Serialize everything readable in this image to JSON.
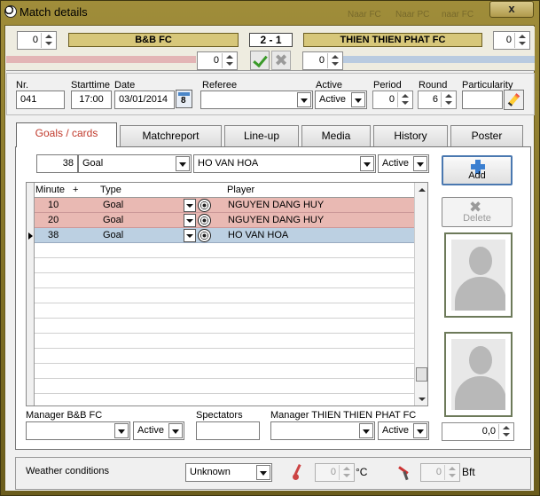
{
  "window": {
    "title": "Match details",
    "ghost_labels": [
      "Naar FC",
      "Naar PC",
      "naar FC"
    ],
    "close_label": "x"
  },
  "score": {
    "home_team": "B&B FC",
    "away_team": "THIEN THIEN PHAT FC",
    "result": "2  - 1",
    "home_left_value": "0",
    "away_right_value": "0",
    "home_sub_value": "0",
    "away_sub_value": "0",
    "colors": {
      "home_bar": "#e3b5b5",
      "away_bar": "#b9cbe0",
      "team_box": "#d7c77a"
    }
  },
  "info": {
    "nr_label": "Nr.",
    "nr_value": "041",
    "starttime_label": "Starttime",
    "starttime_value": "17:00",
    "date_label": "Date",
    "date_value": "03/01/2014",
    "referee_label": "Referee",
    "referee_value": "",
    "active_label": "Active",
    "active_value": "Active",
    "period_label": "Period",
    "period_value": "0",
    "round_label": "Round",
    "round_value": "6",
    "particularity_label": "Particularity",
    "particularity_value": ""
  },
  "tabs": [
    "Goals / cards",
    "Matchreport",
    "Line-up",
    "Media",
    "History",
    "Poster"
  ],
  "entry": {
    "minute": "38",
    "type": "Goal",
    "player": "HO VAN HOA",
    "status": "Active"
  },
  "grid": {
    "headers": {
      "minute": "Minute",
      "plus": "+",
      "type": "Type",
      "player": "Player"
    },
    "rows": [
      {
        "minute": "10",
        "type": "Goal",
        "player": "NGUYEN DANG HUY",
        "team": "home"
      },
      {
        "minute": "20",
        "type": "Goal",
        "player": "NGUYEN DANG HUY",
        "team": "home"
      },
      {
        "minute": "38",
        "type": "Goal",
        "player": "HO VAN HOA",
        "team": "away"
      }
    ],
    "colors": {
      "home_row": "#e9b9b3",
      "away_row": "#bcd0e2"
    }
  },
  "buttons": {
    "add": "Add",
    "delete": "Delete"
  },
  "managers": {
    "home_label": "Manager B&B FC",
    "home_value": "",
    "home_status": "Active",
    "spectators_label": "Spectators",
    "spectators_value": "",
    "away_label": "Manager THIEN THIEN PHAT FC",
    "away_value": "",
    "away_status": "Active",
    "rating_value": "0,0"
  },
  "weather": {
    "label": "Weather conditions",
    "condition": "Unknown",
    "temperature": "0",
    "temp_unit": "°C",
    "wind": "0",
    "wind_unit": "Bft"
  }
}
